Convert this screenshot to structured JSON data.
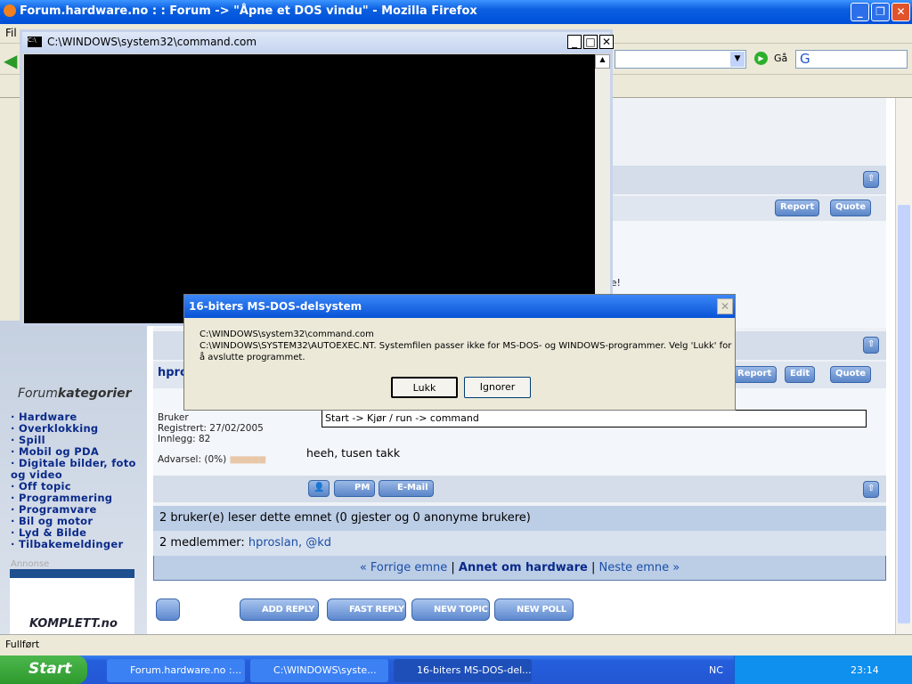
{
  "firefox": {
    "title": "Forum.hardware.no : : Forum -> \"Åpne et DOS vindu\" - Mozilla Firefox",
    "menu_first": "Fil",
    "go_label": "Gå",
    "status": "Fullført"
  },
  "cmd_window": {
    "title": "C:\\WINDOWS\\system32\\command.com"
  },
  "dialog": {
    "title": "16-biters MS-DOS-delsystem",
    "line1": "C:\\WINDOWS\\system32\\command.com",
    "line2": "C:\\WINDOWS\\SYSTEM32\\AUTOEXEC.NT. Systemfilen passer ikke for MS-DOS- og WINDOWS-programmer. Velg 'Lukk' for å avslutte programmet.",
    "ok": "Lukk",
    "ignore": "Ignorer"
  },
  "sidebar": {
    "heading_a": "Forum",
    "heading_b": "kategorier",
    "categories": [
      "· Hardware",
      "· Overklokking",
      "· Spill",
      "· Mobil og PDA",
      "· Digitale bilder, foto og video",
      "· Off topic",
      "· Programmering",
      "· Programvare",
      "· Bil og motor",
      "· Lyd & Bilde",
      "· Tilbakemeldinger"
    ],
    "ad_label": "Annonse",
    "ad_brand": "KOMPLETT.no"
  },
  "post": {
    "partial_text": "ede!",
    "author": "hpro",
    "role": "Bruker",
    "registered": "Registrert: 27/02/2005",
    "posts": "Innlegg: 82",
    "warning": "Advarsel: (0%)",
    "quote": "Start -> Kjør / run -> command",
    "body": "heeh, tusen takk"
  },
  "buttons": {
    "report": "Report",
    "edit": "Edit",
    "quote": "Quote",
    "pm": "PM",
    "email": "E-Mail",
    "add_reply": "ADD REPLY",
    "fast_reply": "FAST REPLY",
    "new_topic": "NEW TOPIC",
    "new_poll": "NEW POLL"
  },
  "footer": {
    "readers": "2 bruker(e) leser dette emnet (0 gjester og 0 anonyme brukere)",
    "members_label": "2 medlemmer:",
    "member1": "hproslan,",
    "member2": "@kd",
    "prev": "« Forrige emne",
    "sep": "|",
    "forum": "Annet om hardware",
    "next": "Neste emne »"
  },
  "taskbar": {
    "start": "Start",
    "tasks": [
      "Forum.hardware.no :...",
      "C:\\WINDOWS\\syste...",
      "16-biters MS-DOS-del..."
    ],
    "lang": "NC",
    "clock": "23:14"
  }
}
